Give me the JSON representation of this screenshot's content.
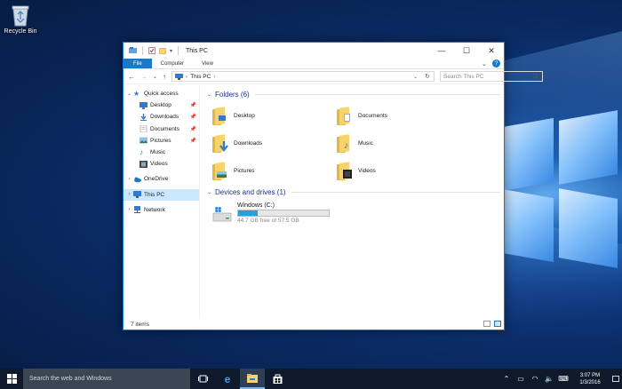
{
  "desktop": {
    "recycle_bin_label": "Recycle Bin"
  },
  "window": {
    "title": "This PC",
    "minimize": "—",
    "maximize": "☐",
    "close": "✕",
    "ribbon_tabs": [
      "File",
      "Computer",
      "View"
    ],
    "address_path": "This PC",
    "search_placeholder": "Search This PC"
  },
  "nav": {
    "quick_access": "Quick access",
    "quick_items": [
      "Desktop",
      "Downloads",
      "Documents",
      "Pictures",
      "Music",
      "Videos"
    ],
    "onedrive": "OneDrive",
    "this_pc": "This PC",
    "network": "Network"
  },
  "main": {
    "folders_header": "Folders (6)",
    "folders": [
      "Desktop",
      "Documents",
      "Downloads",
      "Music",
      "Pictures",
      "Videos"
    ],
    "drives_header": "Devices and drives (1)",
    "drive": {
      "name": "Windows (C:)",
      "free_text": "44.7 GB free of 57.5 GB",
      "used_fraction": 0.22
    }
  },
  "status": {
    "items": "7 items"
  },
  "taskbar": {
    "search_placeholder": "Search the web and Windows",
    "time": "3:07 PM",
    "date": "1/3/2016"
  },
  "colors": {
    "accent": "#1979ca",
    "folder": "#f6d46b",
    "header_text": "#1e3287",
    "taskbar": "#0e1a2b"
  }
}
